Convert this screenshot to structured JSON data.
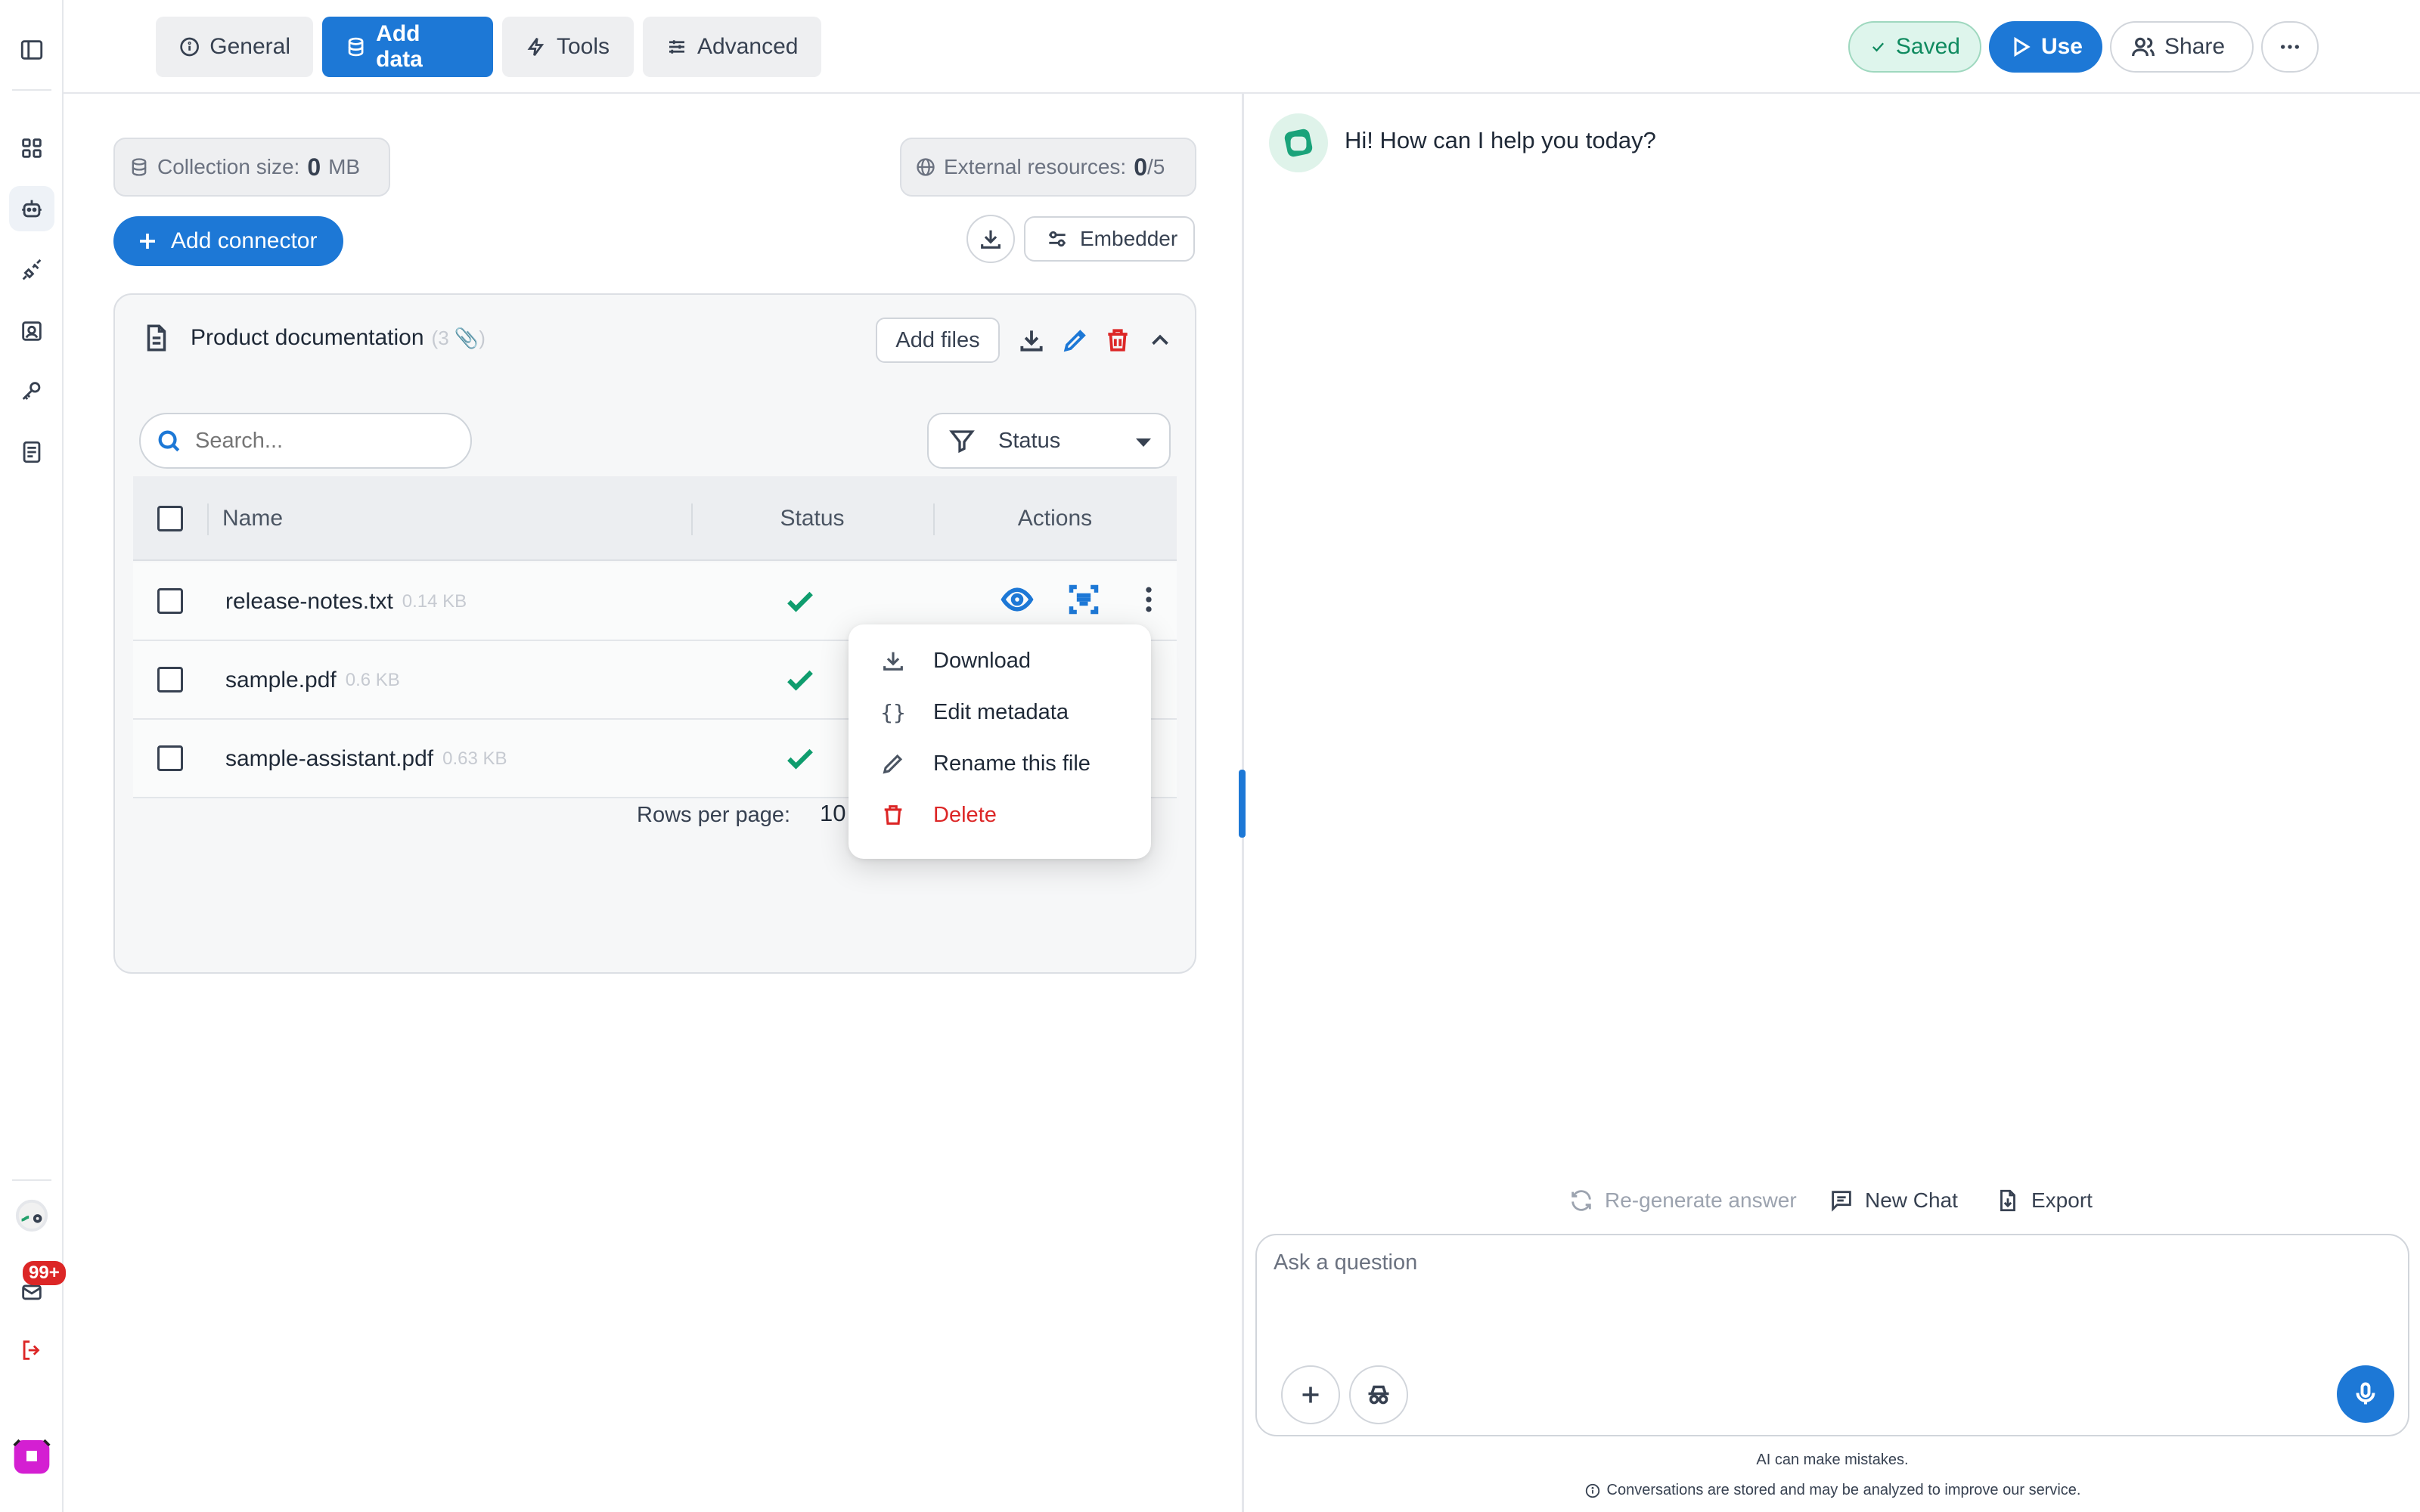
{
  "tabs": [
    {
      "label": "General",
      "icon": "info-icon",
      "active": false
    },
    {
      "label": "Add data",
      "icon": "database-icon",
      "active": true
    },
    {
      "label": "Tools",
      "icon": "bolt-icon",
      "active": false
    },
    {
      "label": "Advanced",
      "icon": "sliders-icon",
      "active": false
    }
  ],
  "header": {
    "saved_label": "Saved",
    "use_label": "Use",
    "share_label": "Share"
  },
  "rail": {
    "notification_badge": "99+"
  },
  "collection": {
    "size_label": "Collection size:",
    "size_value": "0",
    "size_unit": "MB",
    "external_label": "External resources:",
    "external_value": "0",
    "external_max": "/5"
  },
  "actions": {
    "add_connector": "Add connector",
    "embedder": "Embedder"
  },
  "card": {
    "title": "Product documentation",
    "file_count": "(3 📎)",
    "add_files": "Add files"
  },
  "table": {
    "search_placeholder": "Search...",
    "status_filter": "Status",
    "headers": {
      "name": "Name",
      "status": "Status",
      "actions": "Actions"
    },
    "rows": [
      {
        "name": "release-notes.txt",
        "size": "0.14 KB",
        "status": "done"
      },
      {
        "name": "sample.pdf",
        "size": "0.6 KB",
        "status": "done"
      },
      {
        "name": "sample-assistant.pdf",
        "size": "0.63 KB",
        "status": "done"
      }
    ],
    "rows_per_page_label": "Rows per page:",
    "rows_per_page_value": "10"
  },
  "context_menu": {
    "items": [
      {
        "label": "Download",
        "icon": "download-icon"
      },
      {
        "label": "Edit metadata",
        "icon": "braces-icon"
      },
      {
        "label": "Rename this file",
        "icon": "pencil-icon"
      },
      {
        "label": "Delete",
        "icon": "trash-icon"
      }
    ]
  },
  "chat": {
    "greeting": "Hi! How can I help you today?",
    "regenerate": "Re-generate answer",
    "new_chat": "New Chat",
    "export": "Export",
    "input_placeholder": "Ask a question",
    "disclaimer": "AI can make mistakes.",
    "privacy_note": "Conversations are stored and may be analyzed to improve our service."
  },
  "colors": {
    "accent": "#1d78d6",
    "success": "#0f9d6e",
    "danger": "#dc2626",
    "saved_bg": "#def5ec"
  }
}
